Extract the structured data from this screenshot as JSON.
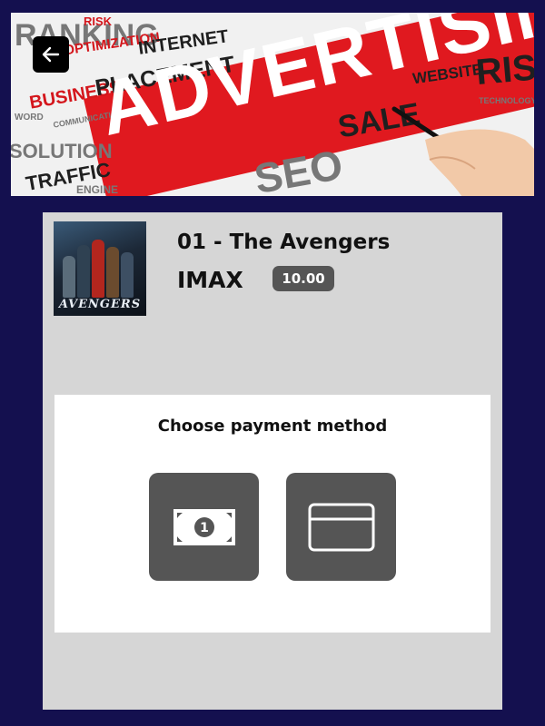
{
  "banner": {
    "headline": "ADVERTISING",
    "words": [
      "RISK",
      "OPTIMIZATION",
      "RANKING",
      "INTERNET",
      "BUSINESS",
      "PLACEMENT",
      "SOLUTION",
      "TRAFFIC",
      "ENGINE",
      "SEO",
      "WEBSITE",
      "TECHNOLOGY",
      "COMMUNICATION",
      "WORD",
      "SALE"
    ]
  },
  "back_button": {
    "icon": "arrow-left-icon"
  },
  "movie": {
    "poster_title": "AVENGERS",
    "title": "01 - The Avengers",
    "format": "IMAX",
    "price": "10.00"
  },
  "payment": {
    "heading": "Choose payment method",
    "methods": [
      {
        "id": "cash",
        "icon": "cash-icon",
        "note_number": "1"
      },
      {
        "id": "card",
        "icon": "credit-card-icon"
      }
    ]
  },
  "colors": {
    "background": "#14104f",
    "panel": "#d6d6d6",
    "button": "#555555",
    "banner_red": "#e0191f"
  }
}
